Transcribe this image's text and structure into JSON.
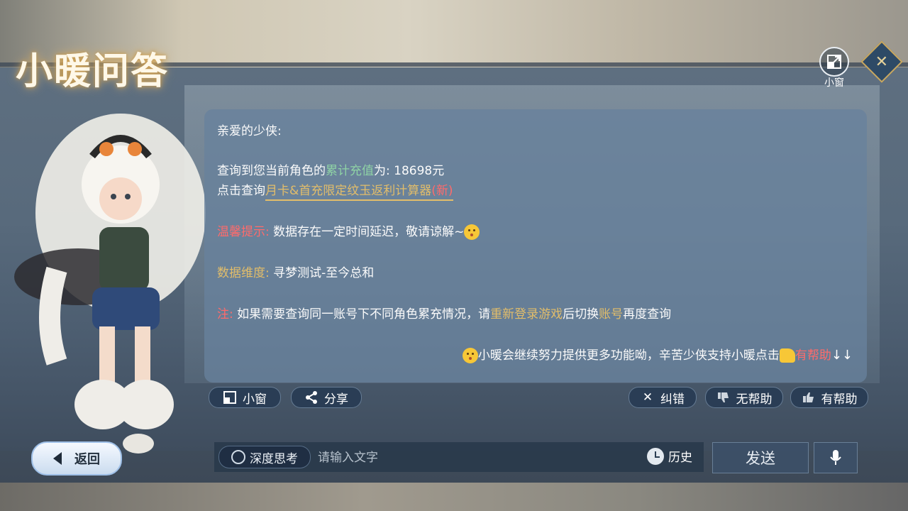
{
  "header": {
    "title": "小暖问答",
    "mini_window_label": "小窗"
  },
  "message": {
    "greeting": "亲爱的少侠:",
    "query_prefix": "查询到您当前角色的",
    "query_highlight": "累计充值",
    "query_middle": "为: ",
    "query_value": "18698元",
    "calc_prefix": "点击查询",
    "calc_link": "月卡&首充限定纹玉返利计算器",
    "calc_new": "(新)",
    "tip_label": "温馨提示:",
    "tip_text": "数据存在一定时间延迟，敬请谅解~",
    "dimension_label": "数据维度:",
    "dimension_value": "寻梦测试-至今总和",
    "note_label": "注:",
    "note_text_1": "如果需要查询同一账号下不同角色累充情况，请",
    "note_highlight_1": "重新登录游戏",
    "note_text_2": "后切换",
    "note_highlight_2": "账号",
    "note_text_3": "再度查询",
    "footer_text": "小暖会继续努力提供更多功能呦，辛苦少侠支持小暖点击",
    "footer_link": "有帮助",
    "footer_arrows": "↓↓"
  },
  "actions": {
    "mini_window": "小窗",
    "share": "分享",
    "report_error": "纠错",
    "not_helpful": "无帮助",
    "helpful": "有帮助"
  },
  "bottom": {
    "back": "返回",
    "deep_think": "深度思考",
    "input_placeholder": "请输入文字",
    "history": "历史",
    "send": "发送"
  },
  "colors": {
    "gold": "#e2bd6a",
    "green": "#8fd3a5",
    "red": "#ff6b6b",
    "panel": "#68829c"
  }
}
